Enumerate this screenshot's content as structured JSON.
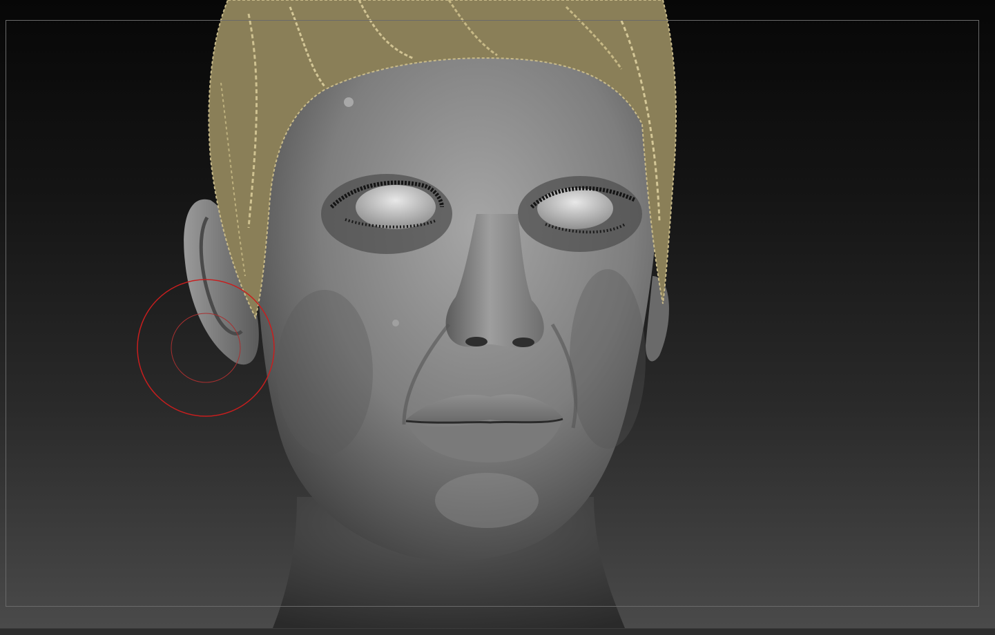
{
  "app": {
    "viewport_name": "3d-sculpt-viewport"
  },
  "colors": {
    "bg_top": "#070707",
    "bg_bottom": "#4a4a4a",
    "frame": "#6a6a6a",
    "brush_outer": "#c81e1e",
    "brush_inner": "#a83030",
    "skin": "#8c8c8c",
    "hair": "#b5a77a"
  },
  "icons": {
    "brush_cursor": "brush-cursor-icon"
  }
}
